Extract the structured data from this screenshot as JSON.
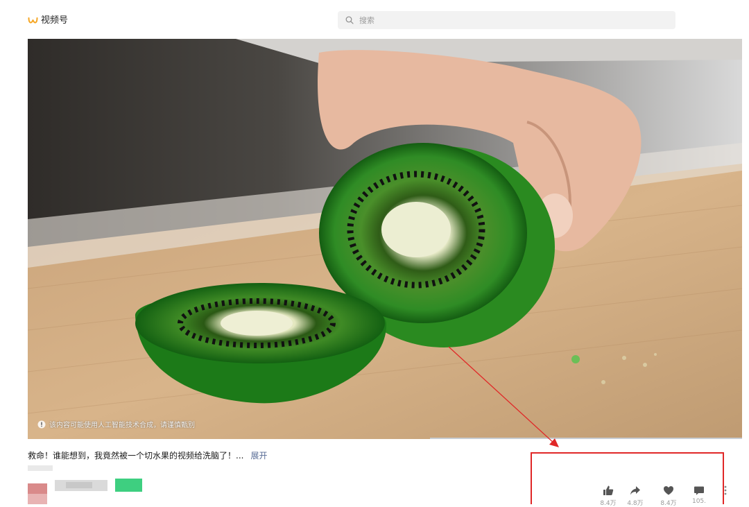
{
  "header": {
    "app_name": "视频号",
    "search_placeholder": "搜索",
    "icons": {
      "logo": "channels-logo-icon",
      "search": "search-icon"
    }
  },
  "video": {
    "ai_notice": "该内容可能使用人工智能技术合成，请谨慎甄别",
    "icons": {
      "notice": "info-icon"
    }
  },
  "post": {
    "caption": "救命！谁能想到，我竟然被一个切水果的视频给洗脑了！...",
    "expand_label": "展开"
  },
  "actions": [
    {
      "name": "like",
      "icon": "thumb-up-icon",
      "count": "8.4万"
    },
    {
      "name": "share",
      "icon": "share-arrow-icon",
      "count": "4.8万"
    },
    {
      "name": "favorite",
      "icon": "heart-icon",
      "count": "8.4万"
    },
    {
      "name": "comment",
      "icon": "comment-icon",
      "count": "105."
    }
  ],
  "colors": {
    "logo": "#f5a623",
    "link": "#576b95",
    "annotation": "#e02727",
    "tag": "#3ecf80"
  }
}
